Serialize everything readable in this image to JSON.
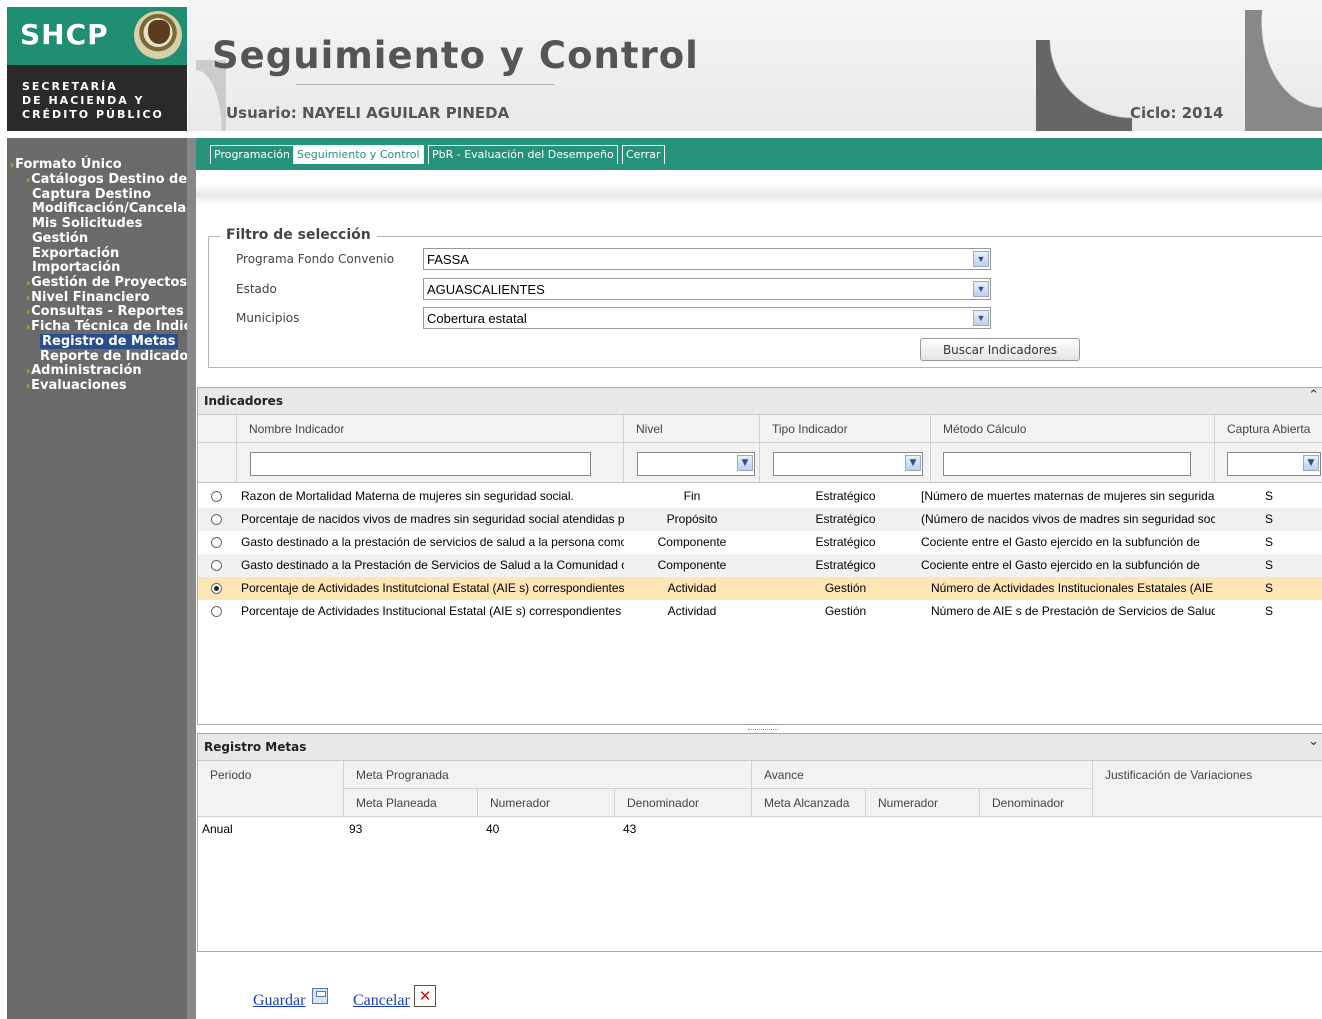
{
  "header": {
    "logo_text": "SHCP",
    "secretaria_lines": "SECRETARÍA\nDE HACIENDA Y\nCRÉDITO PÚBLICO",
    "title": "Seguimiento y Control",
    "usuario": "Usuario: NAYELI AGUILAR PINEDA",
    "ciclo": "Ciclo: 2014"
  },
  "sidebar": {
    "items": [
      {
        "label": "Formato Único"
      },
      {
        "label": "Catálogos Destino del"
      },
      {
        "label": "Captura Destino"
      },
      {
        "label": "Modificación/Cancelac"
      },
      {
        "label": "Mis Solicitudes"
      },
      {
        "label": "Gestión"
      },
      {
        "label": "Exportación"
      },
      {
        "label": "Importación"
      },
      {
        "label": "Gestión de Proyectos"
      },
      {
        "label": "Nivel Financiero"
      },
      {
        "label": "Consultas - Reportes"
      },
      {
        "label": "Ficha Técnica de Indic"
      },
      {
        "label": "Registro de Metas"
      },
      {
        "label": "Reporte de Indicador"
      },
      {
        "label": "Administración"
      },
      {
        "label": "Evaluaciones"
      }
    ]
  },
  "tabs": [
    {
      "label": "Programación"
    },
    {
      "label": "Seguimiento y Control"
    },
    {
      "label": "PbR - Evaluación del Desempeño"
    },
    {
      "label": "Cerrar"
    }
  ],
  "filtro": {
    "legend": "Filtro de selección",
    "programa_label": "Programa Fondo Convenio",
    "programa_value": "FASSA",
    "estado_label": "Estado",
    "estado_value": "AGUASCALIENTES",
    "municipios_label": "Municipios",
    "municipios_value": "Cobertura estatal",
    "buscar_label": "Buscar Indicadores"
  },
  "indicadores": {
    "title": "Indicadores",
    "columns": [
      "Nombre Indicador",
      "Nivel",
      "Tipo Indicador",
      "Método Cálculo",
      "Captura Abierta"
    ],
    "selected_index": 4,
    "rows": [
      {
        "nombre": "Razon de Mortalidad Materna de mujeres sin seguridad social.",
        "nivel": "Fin",
        "tipo": "Estratégico",
        "metodo": "[Número de muertes maternas de mujeres sin seguridad social",
        "captura": "S"
      },
      {
        "nombre": "Porcentaje de nacidos vivos de madres sin seguridad social atendidas por personal médico",
        "nivel": "Propósito",
        "tipo": "Estratégico",
        "metodo": "(Número de nacidos vivos de madres sin seguridad social",
        "captura": "S"
      },
      {
        "nombre": "Gasto destinado a la prestación de servicios de salud a la persona como porcentaje",
        "nivel": "Componente",
        "tipo": "Estratégico",
        "metodo": "Cociente entre el Gasto ejercido en la subfunción de",
        "captura": "S"
      },
      {
        "nombre": "Gasto destinado a la Prestación de Servicios de Salud a la Comunidad como porcentaje",
        "nivel": "Componente",
        "tipo": "Estratégico",
        "metodo": "Cociente entre el Gasto ejercido en la subfunción de",
        "captura": "S"
      },
      {
        "nombre": "Porcentaje de Actividades Institutcional Estatal (AIE s) correspondientes",
        "nivel": "Actividad",
        "tipo": "Gestión",
        "metodo": "Número de Actividades Institucionales Estatales (AIE s)",
        "captura": "S"
      },
      {
        "nombre": "Porcentaje de Actividades Institucional Estatal (AIE s) correspondientes",
        "nivel": "Actividad",
        "tipo": "Gestión",
        "metodo": "Número de AIE s de Prestación de Servicios de Salud",
        "captura": "S"
      }
    ]
  },
  "registro": {
    "title": "Registro Metas",
    "col_periodo": "Periodo",
    "col_meta_programada": "Meta Progranada",
    "col_avance": "Avance",
    "col_justificacion": "Justificación de Variaciones",
    "col_meta_planeada": "Meta Planeada",
    "col_numerador": "Numerador",
    "col_denominador": "Denominador",
    "col_meta_alcanzada": "Meta Alcanzada",
    "row": {
      "periodo": "Anual",
      "meta": "93",
      "numerador": "40",
      "denominador": "43"
    }
  },
  "actions": {
    "guardar": "Guardar",
    "cancelar": "Cancelar"
  },
  "colors": {
    "brand_green": "#26937a",
    "sidebar_gray": "#6a6a6a",
    "selected_row": "#fde6b5",
    "link_blue": "#1a3dbd"
  }
}
